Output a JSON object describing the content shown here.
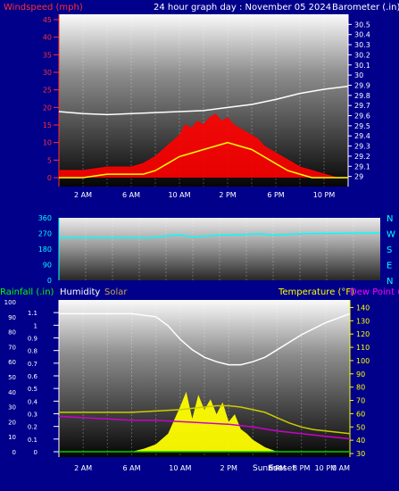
{
  "header": {
    "left_title": "Windspeed (mph)",
    "center_title": "24 hour graph day : November 05 2024",
    "right_title": "Barometer (.in)"
  },
  "panel3_header": {
    "rainfall_label": "Rainfall (.in)",
    "humidity_label": "Humidity",
    "solar_label": "Solar",
    "temperature_label": "Temperature (°F)",
    "dewpoint_label": "Dew Point ("
  },
  "colors": {
    "background": "#00008b",
    "wind_speed": "#ff0000",
    "wind_avg": "#ffff00",
    "barometer": "#ffffff",
    "wind_direction": "#00ffff",
    "humidity": "#ffffff",
    "solar": "#ffff00",
    "temperature": "#cccc00",
    "dew_point": "#cc00cc",
    "rainfall": "#00cc00",
    "left_axis": "#ff3030",
    "right_axis": "#ffffff",
    "dir_axis": "#00ffff",
    "temp_axis": "#ffff00",
    "dew_label": "#ff00ff",
    "solar_label": "#c8a64a"
  },
  "chart_data": [
    {
      "type": "line",
      "name": "wind-barometer",
      "x_tick_labels": [
        "2 AM",
        "6 AM",
        "10 AM",
        "2 PM",
        "6 PM",
        "10 PM"
      ],
      "x_tick_hours": [
        2,
        6,
        10,
        14,
        18,
        22
      ],
      "x_range_hours": [
        0,
        24
      ],
      "left_axis": {
        "ticks": [
          "45",
          "40",
          "35",
          "30",
          "25",
          "20",
          "15",
          "10",
          "5",
          "0"
        ],
        "range": [
          0,
          45
        ]
      },
      "right_axis": {
        "ticks": [
          "30.5",
          "30.4",
          "30.3",
          "30.2",
          "30.1",
          "30",
          "29.9",
          "29.8",
          "29.7",
          "29.6",
          "29.5",
          "29.4",
          "29.3",
          "29.2",
          "29.1",
          "29"
        ],
        "range": [
          28.9,
          30.6
        ]
      },
      "series": [
        {
          "x": [
            0,
            2,
            4,
            6,
            7,
            8,
            9,
            10,
            10.5,
            11,
            11.5,
            12,
            12.5,
            13,
            13.5,
            14,
            14.5,
            15,
            15.5,
            16,
            16.5,
            17,
            18,
            19,
            20,
            21,
            22,
            23,
            24
          ],
          "values": [
            2,
            2,
            3,
            3,
            4,
            6,
            9,
            12,
            15,
            14,
            16,
            15,
            17,
            18,
            16,
            17,
            15,
            14,
            13,
            12,
            11,
            9,
            7,
            5,
            3,
            2,
            1,
            0,
            0
          ]
        },
        {
          "x": [
            0,
            2,
            4,
            6,
            7,
            8,
            9,
            10,
            11,
            12,
            13,
            14,
            15,
            16,
            17,
            18,
            19,
            20,
            21,
            22,
            23,
            24
          ],
          "values": [
            0,
            0,
            1,
            1,
            1,
            2,
            4,
            6,
            7,
            8,
            9,
            10,
            9,
            8,
            6,
            4,
            2,
            1,
            0,
            0,
            0,
            0
          ]
        },
        {
          "x": [
            0,
            2,
            4,
            6,
            8,
            10,
            12,
            14,
            16,
            18,
            20,
            22,
            24
          ],
          "values": [
            29.64,
            29.62,
            29.61,
            29.62,
            29.63,
            29.64,
            29.65,
            29.68,
            29.71,
            29.76,
            29.82,
            29.86,
            29.89
          ]
        }
      ]
    },
    {
      "type": "line",
      "name": "wind-direction",
      "left_axis": {
        "ticks": [
          "360",
          "270",
          "180",
          "90",
          "0"
        ],
        "range": [
          0,
          360
        ]
      },
      "right_axis": {
        "ticks": [
          "N",
          "W",
          "S",
          "E",
          "N"
        ]
      },
      "x_range_hours": [
        0,
        24
      ],
      "series": [
        {
          "x": [
            0,
            2,
            4,
            6,
            7,
            8,
            9,
            10,
            11,
            12,
            13,
            14,
            15,
            16,
            17,
            18,
            19,
            20,
            21,
            22,
            23,
            24
          ],
          "values": [
            245,
            245,
            245,
            245,
            246,
            255,
            262,
            250,
            255,
            260,
            262,
            265,
            268,
            262,
            265,
            268,
            270,
            270,
            270,
            272,
            272,
            272
          ]
        }
      ]
    },
    {
      "type": "line",
      "name": "humidity-solar-temperature",
      "x_tick_labels": [
        "2 AM",
        "6 AM",
        "10 AM",
        "2 PM",
        "6 PM",
        "8 PM",
        "10 PM",
        "0 AM"
      ],
      "x_tick_hours": [
        2,
        6,
        10,
        14,
        18,
        20,
        22,
        24
      ],
      "event_labels": [
        "Sunrise",
        "Sunset"
      ],
      "x_range_hours": [
        0,
        24
      ],
      "humidity_axis": {
        "ticks": [
          "100",
          "90",
          "80",
          "70",
          "60",
          "50",
          "40",
          "30",
          "20",
          "10",
          "0"
        ],
        "range": [
          0,
          100
        ]
      },
      "rain_axis": {
        "ticks": [
          "1.1",
          "1",
          "0.9",
          "0.8",
          "0.7",
          "0.6",
          "0.5",
          "0.4",
          "0.3",
          "0.2",
          "0.1",
          "0"
        ],
        "range": [
          0,
          1.2
        ]
      },
      "temp_axis": {
        "ticks": [
          "140",
          "130",
          "120",
          "110",
          "100",
          "90",
          "80",
          "70",
          "60",
          "50",
          "40",
          "30"
        ],
        "range": [
          30,
          145
        ]
      },
      "series": [
        {
          "x": [
            0,
            2,
            4,
            6,
            8,
            9,
            10,
            11,
            12,
            13,
            14,
            15,
            16,
            17,
            18,
            20,
            22,
            24
          ],
          "values": [
            92,
            92,
            92,
            92,
            90,
            84,
            75,
            68,
            63,
            60,
            58,
            58,
            60,
            63,
            68,
            78,
            86,
            92
          ]
        },
        {
          "x": [
            0,
            6,
            7,
            8,
            9,
            10,
            10.5,
            11,
            11.5,
            12,
            12.5,
            13,
            13.5,
            14,
            14.5,
            15,
            15.5,
            16,
            17,
            18,
            24
          ],
          "values": [
            0,
            0,
            2,
            5,
            12,
            30,
            40,
            22,
            38,
            28,
            35,
            25,
            33,
            20,
            25,
            15,
            12,
            8,
            3,
            0,
            0
          ]
        },
        {
          "x": [
            0,
            2,
            4,
            6,
            8,
            10,
            11,
            12,
            13,
            14,
            15,
            16,
            17,
            18,
            19,
            20,
            21,
            22,
            23,
            24
          ],
          "values": [
            61,
            61,
            61,
            61,
            62,
            63,
            64,
            65,
            66,
            66,
            65,
            63,
            61,
            57,
            53,
            50,
            48,
            47,
            46,
            45
          ]
        },
        {
          "x": [
            0,
            2,
            4,
            6,
            8,
            10,
            12,
            14,
            16,
            18,
            20,
            22,
            24
          ],
          "values": [
            58,
            57,
            56,
            55,
            55,
            54,
            53,
            52,
            50,
            47,
            45,
            43,
            41
          ]
        },
        {
          "x": [
            0,
            24
          ],
          "values": [
            0,
            0
          ]
        }
      ]
    }
  ]
}
